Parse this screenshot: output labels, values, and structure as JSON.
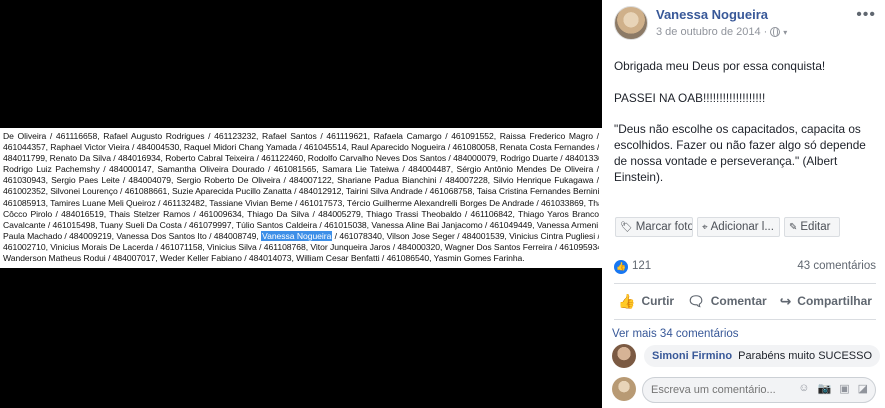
{
  "document_lines": [
    "De Oliveira / 461116658, Rafael Augusto Rodrigues / 461123232, Rafael Santos / 461119621, Rafaela Camargo / 461091552, Raissa Frederico Magro /",
    "461044357, Raphael Victor Vieira / 484004530, Raquel Midori Chang Yamada / 461045514, Raul Aparecido Nogueira / 461080058, Renata Costa Fernandes /",
    "484011799, Renato Da Silva / 484016934, Roberto Cabral Teixeira / 461122460, Rodolfo Carvalho Neves Dos Santos / 484000079, Rodrigo Duarte / 484013368,",
    "Rodrigo Luiz Pachemshy / 484000147, Samantha Oliveira Dourado / 461081565, Samara Lie Tateiwa / 484004487, Sérgio Antônio Mendes De Oliveira /",
    "461030943, Sergio Paes Leite / 484004079, Sergio Roberto De Oliveira / 484007122, Shariane Padua Bianchini / 484007228, Silvio Henrique Fukagawa /",
    "461002352, Silvonei Lourenço / 461088661, Suzie Aparecida Pucillo Zanatta / 484012912, Tairini Silva Andrade / 461068758, Taisa Cristina Fernandes Bernini /",
    "461085913, Tamires Luane Meli Queiroz / 461132482, Tassiane Vivian Beme / 461017573, Tércio Guilherme Alexandrelli Borges De Andrade / 461033869, Thais",
    "Côcco Pirolo / 484016519, Thais Stelzer Ramos / 461009634, Thiago Da Silva / 484005279, Thiago Trassi Theobaldo / 461106842, Thiago Yaros Branco",
    "Cavalcante / 461015498, Tuany Sueli Da Costa / 461079997, Túlio Santos Caldeira / 461015038, Vanessa Aline Bai Janjacomo / 461049449, Vanessa Armeni De",
    "Paula Machado / 484009219, Vanessa Dos Santos Ito / 484008749, ",
    "461002710, Vinicius Morais De Lacerda / 461071158, Vinicius Silva / 461108768, Vitor Junqueira Jaros / 484000320, Wagner Dos Santos Ferreira / 461095934,",
    "Wanderson Matheus Rodui / 484007017, Weder Keller Fabiano / 484014073, William Cesar Benfatti / 461086540, Yasmin Gomes Farinha."
  ],
  "document_highlight": "Vanessa Nogueira",
  "document_line10_tail": " / 461078340, Vilson Jose Seger / 484001539, Vinicius Cintra Pugliesi /",
  "post": {
    "author": "Vanessa Nogueira",
    "date": "3 de outubro de 2014",
    "privacy_icon": "globe-icon",
    "text_1": "Obrigada meu Deus por essa conquista!",
    "text_2": "PASSEI NA OAB!!!!!!!!!!!!!!!!!!!",
    "text_3": "\"Deus não escolhe os capacitados, capacita os escolhidos. Fazer ou não fazer algo só depende de nossa vontade e perseverança.\" (Albert Einstein)."
  },
  "photo_actions": {
    "tag": "Marcar foto",
    "location": "Adicionar l...",
    "edit": "Editar"
  },
  "reactions": {
    "count": "121",
    "comments": "43 comentários"
  },
  "actions": {
    "like": "Curtir",
    "comment": "Comentar",
    "share": "Compartilhar"
  },
  "comments": {
    "more_label": "Ver mais 34 comentários",
    "items": [
      {
        "author": "Simoni Firmino",
        "text": "Parabéns muito SUCESSO"
      }
    ],
    "composer_placeholder": "Escreva um comentário..."
  },
  "colors": {
    "link": "#385898",
    "highlight": "#3d8fe8",
    "like": "#1877f2"
  }
}
